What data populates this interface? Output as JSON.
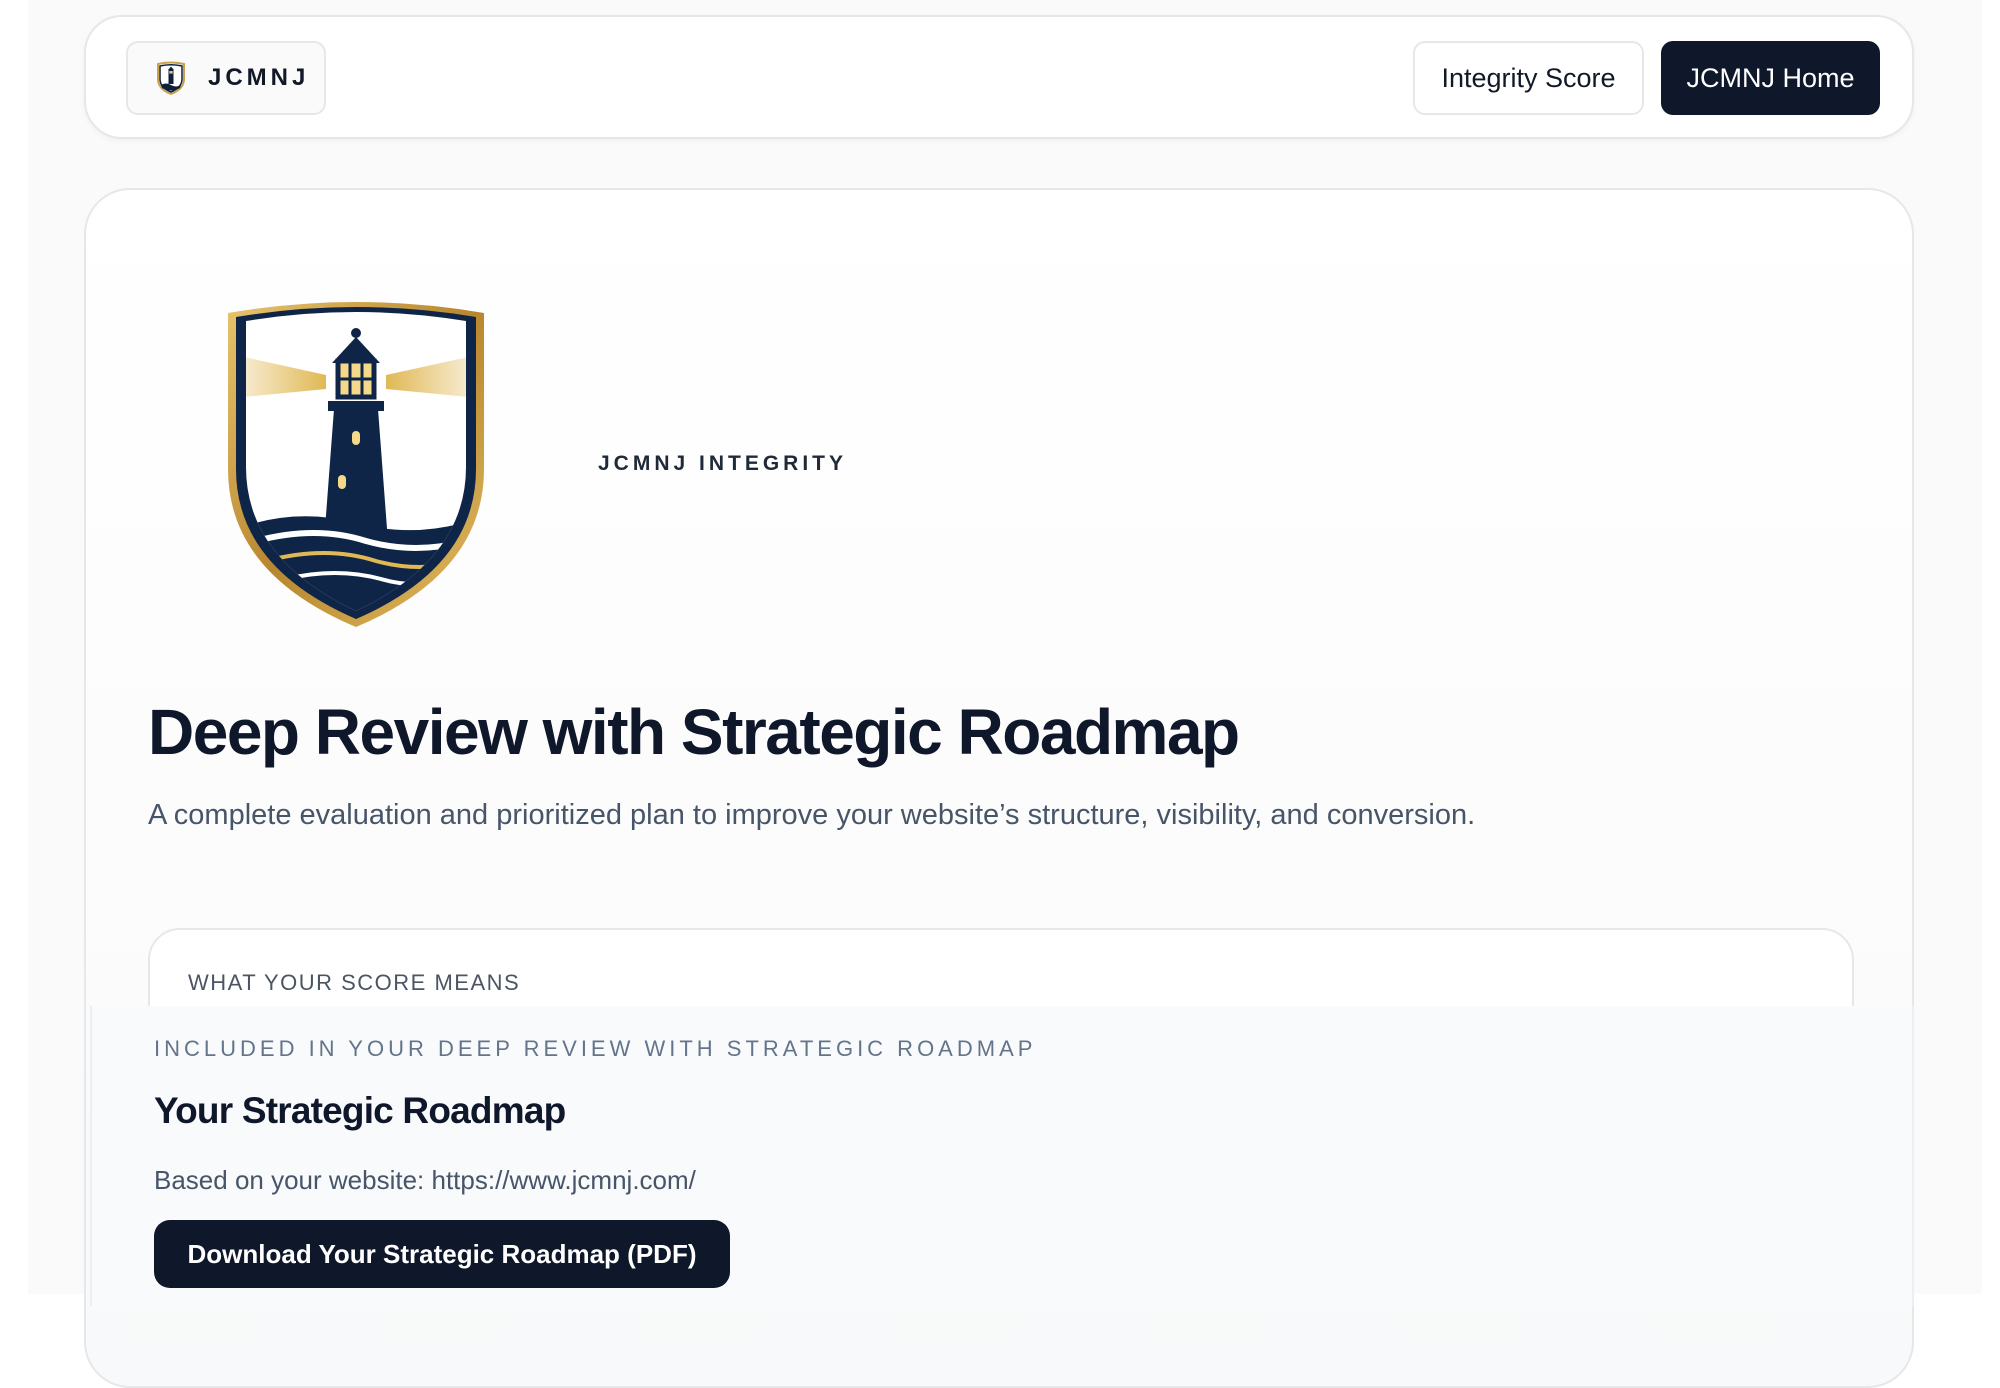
{
  "nav": {
    "brand_label": "JCMNJ",
    "integrity_score_label": "Integrity Score",
    "home_label": "JCMNJ Home"
  },
  "hero": {
    "eyebrow": "JCMNJ INTEGRITY",
    "title": "Deep Review with Strategic Roadmap",
    "subtitle": "A complete evaluation and prioritized plan to improve your website’s structure, visibility, and conversion.",
    "score_box_title": "WHAT YOUR SCORE MEANS"
  },
  "roadmap": {
    "included_label": "INCLUDED IN YOUR DEEP REVIEW WITH STRATEGIC ROADMAP",
    "title": "Your Strategic Roadmap",
    "based_on": "Based on your website: https://www.jcmnj.com/",
    "download_label": "Download Your Strategic Roadmap (PDF)"
  },
  "icons": {
    "brand_logo": "lighthouse-shield-icon",
    "crest_logo": "lighthouse-shield-crest"
  },
  "colors": {
    "navy": "#0f172a",
    "gold": "#c9a24a",
    "border": "#e5e7eb",
    "muted_text": "#475569"
  }
}
